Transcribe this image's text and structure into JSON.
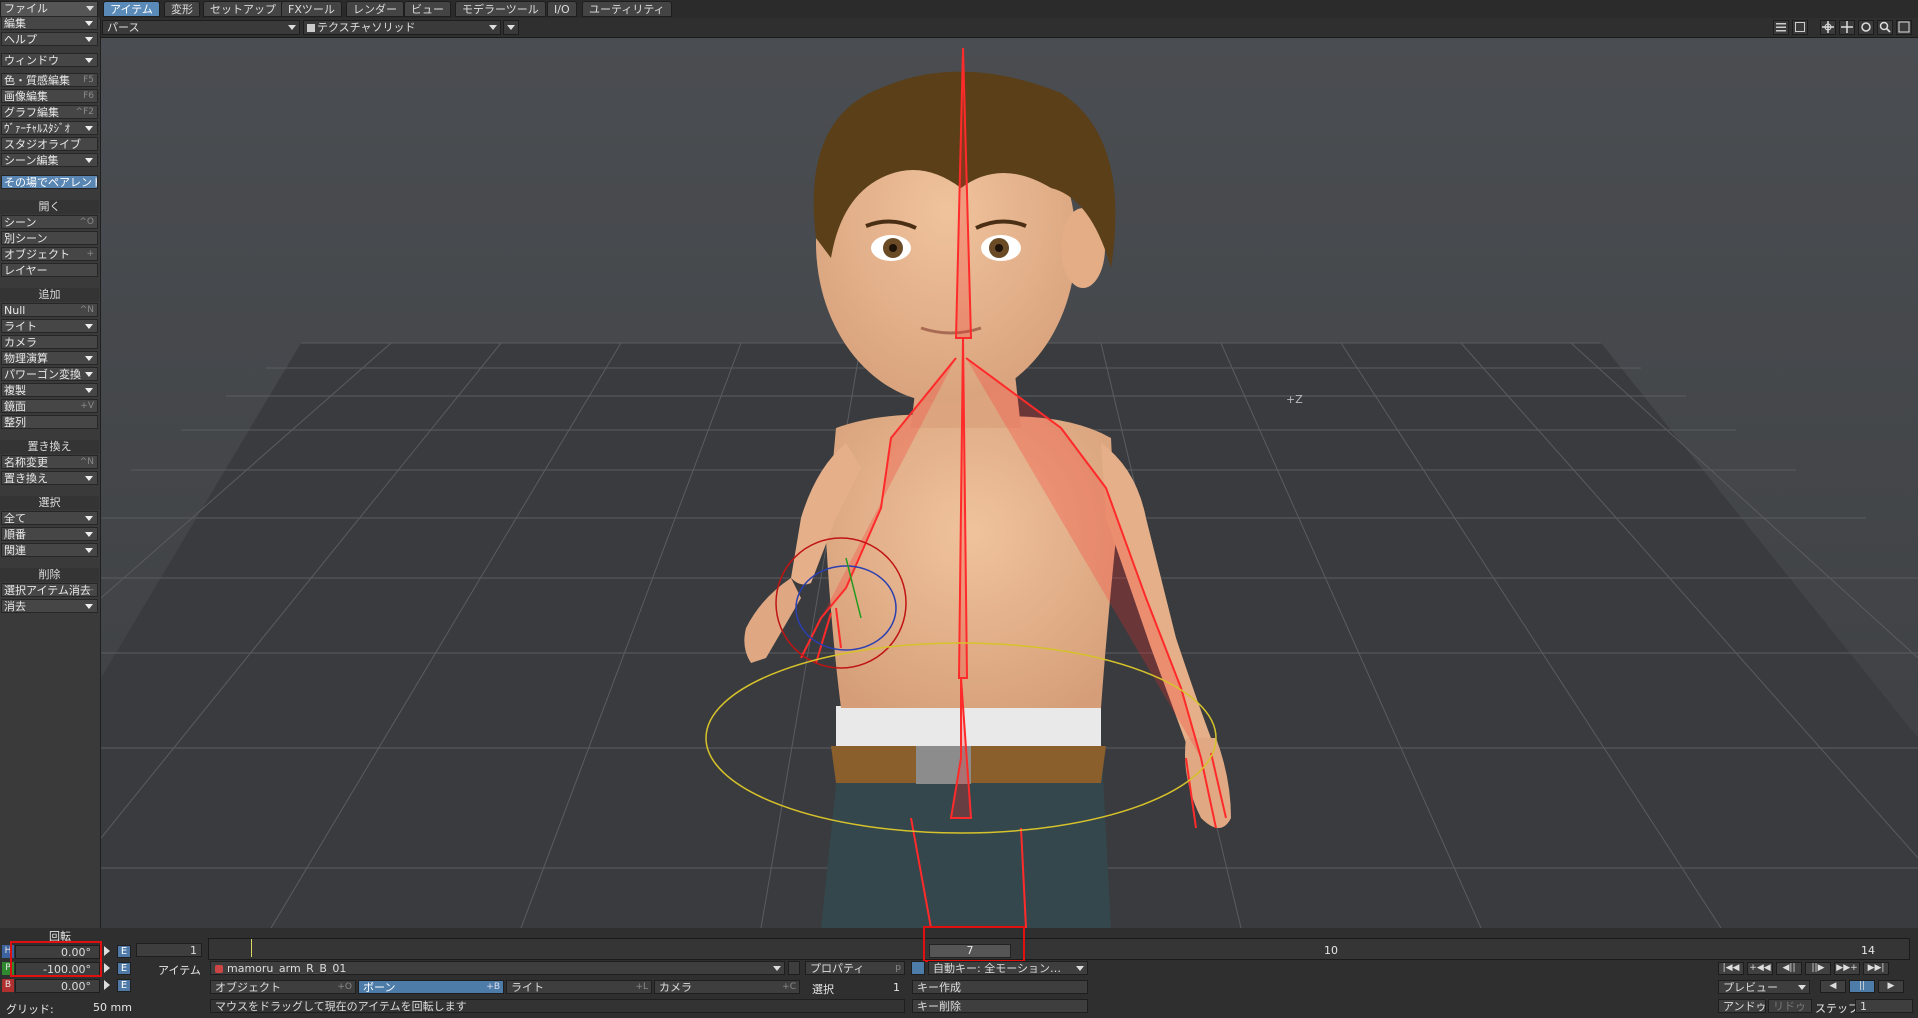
{
  "menu": {
    "file": "ファイル",
    "tabs": [
      "アイテム",
      "変形",
      "セットアップ",
      "FXツール",
      "レンダー",
      "ビュー",
      "モデラーツール",
      "I/O",
      "ユーティリティ"
    ],
    "active_tab": "アイテム"
  },
  "viewport_header": {
    "view_mode": "パース",
    "render_mode": "テクスチャソリッド"
  },
  "left": {
    "edit": "編集",
    "help": "ヘルプ",
    "window": "ウィンドウ",
    "surface_editor": "色・質感編集",
    "surface_editor_sc": "F5",
    "image_editor": "画像編集",
    "image_editor_sc": "F6",
    "graph_editor": "グラフ編集",
    "graph_editor_sc": "^F2",
    "virtual_studio": "ｳﾞｧｰﾁｬﾙｽﾀｼﾞｵ",
    "studio_live": "スタジオライブ",
    "scene_editor": "シーン編集",
    "parent_in_place": "その場でペアレント",
    "open_header": "開く",
    "scene": "シーン",
    "scene_sc": "^O",
    "other_scene": "別シーン",
    "object": "オブジェクト",
    "object_sc": "+",
    "layer": "レイヤー",
    "add_header": "追加",
    "null": "Null",
    "null_sc": "^N",
    "light": "ライト",
    "camera": "カメラ",
    "physics": "物理演算",
    "polygon_convert": "パワーゴン変換",
    "clone": "複製",
    "mirror": "鏡面",
    "mirror_sc": "+V",
    "align": "整列",
    "replace_header": "置き換え",
    "rename": "名称変更",
    "rename_sc": "^N",
    "replace": "置き換え",
    "select_header": "選択",
    "all": "全て",
    "order": "順番",
    "related": "関連",
    "delete_header": "削除",
    "clear_selected": "選択アイテム消去",
    "clear_selected_sc": "-",
    "clear": "消去"
  },
  "rotation": {
    "header": "回転",
    "h_label": "H",
    "h_value": "0.00°",
    "p_label": "P",
    "p_value": "-100.00°",
    "b_label": "B",
    "b_value": "0.00°",
    "grid_label": "グリッド:",
    "grid_value": "50 mm"
  },
  "timeline": {
    "start": "1",
    "current": "7",
    "tick_10": "10",
    "end": "14"
  },
  "item": {
    "label": "アイテム",
    "current": "mamoru_arm_R_B_01",
    "properties": "プロパティ",
    "properties_sc": "p",
    "auto_key": "自動キー: 全モーション…",
    "object": "オブジェクト",
    "object_sc": "+O",
    "bone": "ボーン",
    "bone_sc": "+B",
    "light": "ライト",
    "light_sc": "+L",
    "camera": "カメラ",
    "camera_sc": "+C",
    "select_label": "選択",
    "select_value": "1",
    "create_key": "キー作成",
    "delete_key": "キー削除",
    "hint": "マウスをドラッグして現在のアイテムを回転します"
  },
  "playback": {
    "preview": "プレビュー",
    "undo": "アンドゥ",
    "redo": "リドゥ",
    "step_label": "ステップ",
    "step_value": "1"
  }
}
